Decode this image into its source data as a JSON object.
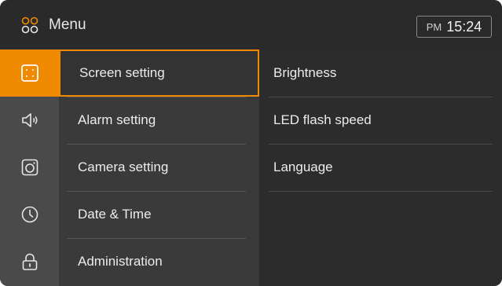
{
  "header": {
    "title": "Menu",
    "menu_icon": "menu-grid-icon",
    "clock": {
      "ampm": "PM",
      "time": "15:24"
    }
  },
  "sidebar": {
    "items": [
      {
        "icon": "screen-icon",
        "active": true
      },
      {
        "icon": "speaker-icon",
        "active": false
      },
      {
        "icon": "camera-icon",
        "active": false
      },
      {
        "icon": "clock-icon",
        "active": false
      },
      {
        "icon": "lock-icon",
        "active": false
      }
    ]
  },
  "menu": {
    "items": [
      {
        "label": "Screen setting",
        "active": true
      },
      {
        "label": "Alarm setting",
        "active": false
      },
      {
        "label": "Camera setting",
        "active": false
      },
      {
        "label": "Date & Time",
        "active": false
      },
      {
        "label": "Administration",
        "active": false
      }
    ]
  },
  "panel": {
    "items": [
      {
        "label": "Brightness"
      },
      {
        "label": "LED flash speed"
      },
      {
        "label": "Language"
      }
    ]
  },
  "colors": {
    "accent": "#f08a00",
    "header_bg": "#2a2a2a",
    "sidebar_bg": "#4a4a4a",
    "menu_bg": "#3a3a3a",
    "panel_bg": "#2c2c2c"
  }
}
